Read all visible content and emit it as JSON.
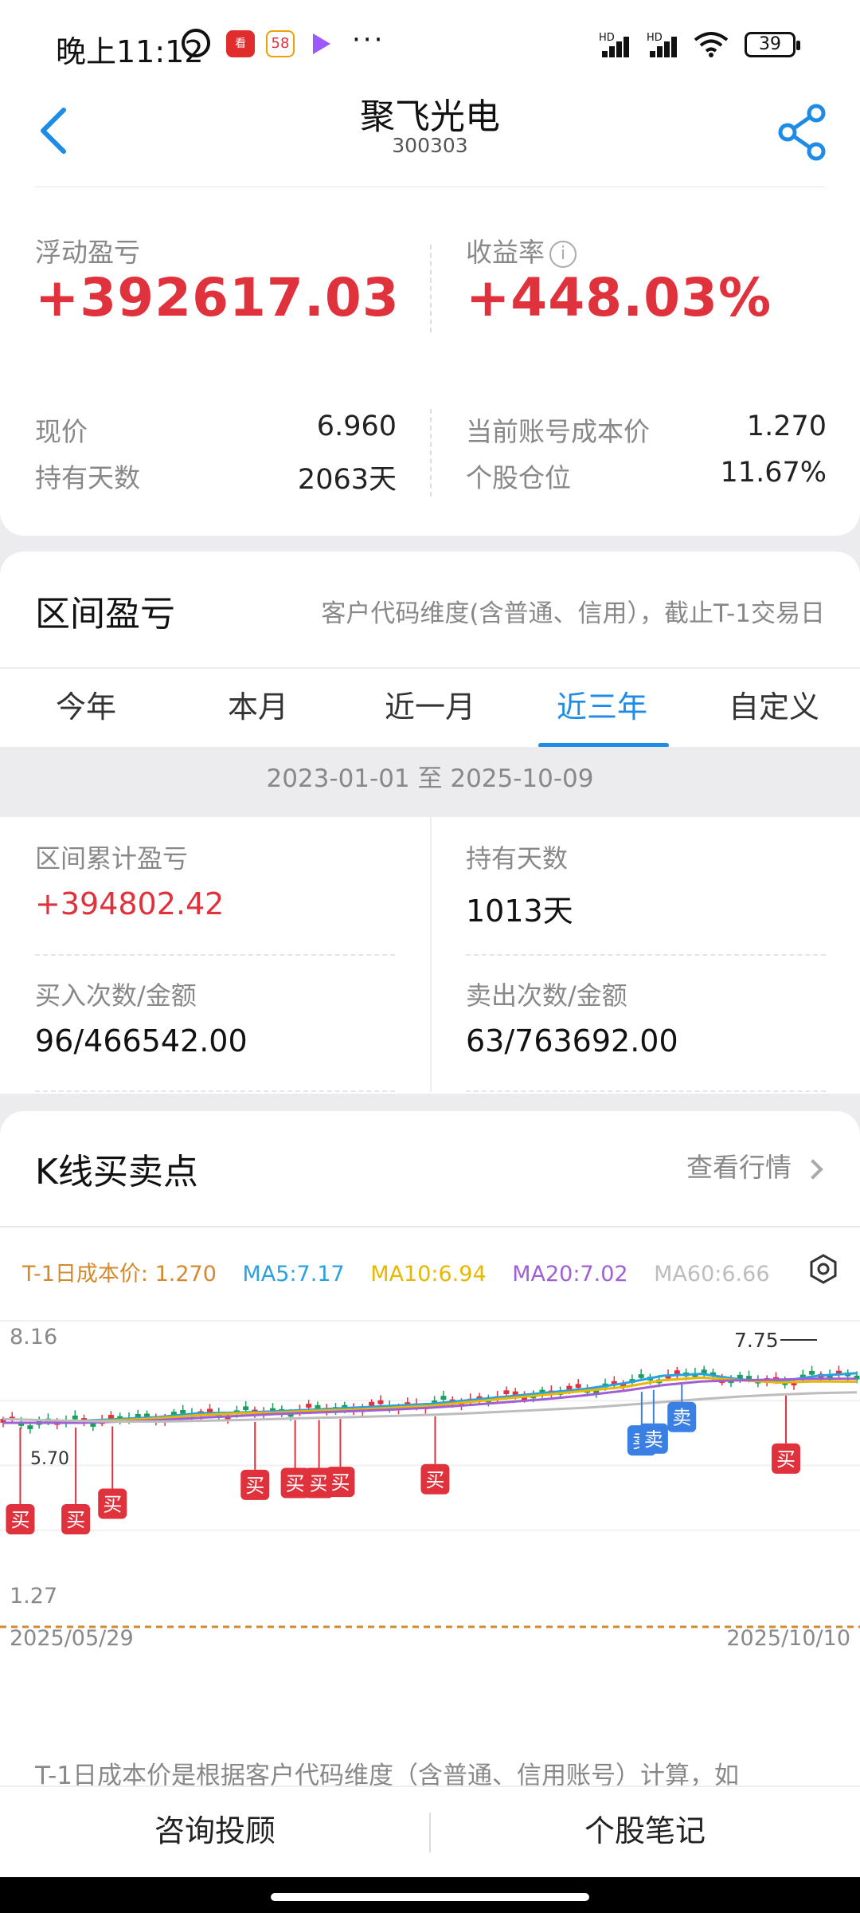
{
  "status": {
    "time": "晚上11:12",
    "battery": "39",
    "more": "···",
    "net1": "HD",
    "net2": "HD"
  },
  "header": {
    "title": "聚飞光电",
    "code": "300303"
  },
  "summary": {
    "float_label": "浮动盈亏",
    "float_value": "+392617.03",
    "return_label": "收益率",
    "return_value": "+448.03%",
    "price_label": "现价",
    "price_value": "6.960",
    "hold_days_label": "持有天数",
    "hold_days_value": "2063天",
    "cost_label": "当前账号成本价",
    "cost_value": "1.270",
    "position_label": "个股仓位",
    "position_value": "11.67%"
  },
  "interval": {
    "title": "区间盈亏",
    "note": "客户代码维度(含普通、信用），截止T-1交易日",
    "tabs": [
      "今年",
      "本月",
      "近一月",
      "近三年",
      "自定义"
    ],
    "active_tab": 3,
    "date_range": "2023-01-01 至 2025-10-09",
    "pnl_label": "区间累计盈亏",
    "pnl_value": "+394802.42",
    "days_label": "持有天数",
    "days_value": "1013天",
    "buy_label": "买入次数/金额",
    "buy_value": "96/466542.00",
    "sell_label": "卖出次数/金额",
    "sell_value": "63/763692.00"
  },
  "kline": {
    "title": "K线买卖点",
    "view_more": "查看行情",
    "legend": {
      "cost": "T-1日成本价: 1.270",
      "ma5": "MA5:7.17",
      "ma10": "MA10:6.94",
      "ma20": "MA20:7.02",
      "ma60": "MA60:6.66"
    },
    "colors": {
      "cost": "#d4892e",
      "ma5": "#2aa1e0",
      "ma10": "#e8b800",
      "ma20": "#a15fd6",
      "ma60": "#bdbdbd",
      "up": "#e0323c",
      "down": "#1aa05a",
      "buy": "#e0323c",
      "sell": "#3a7fe3"
    },
    "footnote": "T-1日成本价是根据客户代码维度（含普通、信用账号）计算，如"
  },
  "chart_data": {
    "type": "line",
    "title": "",
    "y_max_label": "8.16",
    "y_min_label": "1.27",
    "x_start_label": "2025/05/29",
    "x_end_label": "2025/10/10",
    "high_label": "7.75",
    "low_label": "5.70",
    "ylim": [
      1.27,
      8.16
    ],
    "cost_line": 1.27,
    "series": [
      {
        "name": "MA5",
        "values": [
          5.85,
          5.85,
          5.9,
          5.95,
          6.0,
          6.1,
          6.12,
          6.15,
          6.2,
          6.25,
          6.3,
          6.35,
          6.45,
          6.55,
          6.65,
          6.75,
          6.9,
          7.1,
          7.15,
          7.0,
          6.95,
          7.1,
          7.17
        ]
      },
      {
        "name": "MA10",
        "values": [
          5.85,
          5.85,
          5.88,
          5.92,
          5.97,
          6.05,
          6.1,
          6.12,
          6.17,
          6.2,
          6.25,
          6.3,
          6.4,
          6.5,
          6.6,
          6.7,
          6.8,
          6.98,
          7.05,
          6.98,
          6.92,
          6.95,
          6.94
        ]
      },
      {
        "name": "MA20",
        "values": [
          5.85,
          5.85,
          5.85,
          5.88,
          5.92,
          5.98,
          6.03,
          6.08,
          6.12,
          6.16,
          6.2,
          6.25,
          6.32,
          6.4,
          6.48,
          6.58,
          6.7,
          6.85,
          6.95,
          6.98,
          7.0,
          7.02,
          7.02
        ]
      },
      {
        "name": "MA60",
        "values": [
          5.95,
          5.92,
          5.9,
          5.88,
          5.88,
          5.9,
          5.92,
          5.95,
          5.98,
          6.0,
          6.03,
          6.06,
          6.1,
          6.15,
          6.2,
          6.25,
          6.32,
          6.4,
          6.48,
          6.55,
          6.6,
          6.64,
          6.66
        ]
      }
    ],
    "markers": [
      {
        "type": "买",
        "x": 0.02,
        "price": 5.85,
        "level": 3
      },
      {
        "type": "买",
        "x": 0.085,
        "price": 5.85,
        "level": 3
      },
      {
        "type": "买",
        "x": 0.128,
        "price": 5.88,
        "level": 2
      },
      {
        "type": "买",
        "x": 0.295,
        "price": 6.0,
        "level": 1
      },
      {
        "type": "买",
        "x": 0.342,
        "price": 6.05,
        "level": 1
      },
      {
        "type": "买",
        "x": 0.37,
        "price": 6.05,
        "level": 1
      },
      {
        "type": "买",
        "x": 0.395,
        "price": 6.08,
        "level": 1
      },
      {
        "type": "买",
        "x": 0.506,
        "price": 6.15,
        "level": 1
      },
      {
        "type": "卖",
        "x": 0.748,
        "price": 6.8,
        "level": 0
      },
      {
        "type": "卖",
        "x": 0.762,
        "price": 6.85,
        "level": 0
      },
      {
        "type": "卖",
        "x": 0.795,
        "price": 7.0,
        "level": -1
      },
      {
        "type": "买",
        "x": 0.917,
        "price": 6.7,
        "level": 1
      }
    ]
  },
  "bottom": {
    "consult": "咨询投顾",
    "notes": "个股笔记"
  }
}
